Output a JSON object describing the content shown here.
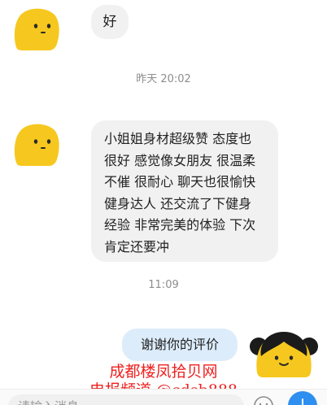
{
  "messages": {
    "first": {
      "text": "好"
    },
    "second": {
      "lines": [
        "小姐姐身材超级赞 态度也",
        "很好 感觉像女朋友 很温柔",
        "不催 很耐心 聊天也很愉快",
        "健身达人 还交流了下健身",
        "经验 非常完美的体验 下次",
        "肯定还要冲"
      ]
    },
    "reply": {
      "text": "谢谢你的评价"
    }
  },
  "timestamps": {
    "first": "昨天 20:02",
    "second": "11:09"
  },
  "watermark": {
    "line1": "成都楼凤拾贝网",
    "line2": "电报频道 @cdsb888"
  },
  "input": {
    "placeholder": "请输入消息"
  },
  "colors": {
    "avatar_yellow": "#f6c81f",
    "reply_bubble": "#dcecfb",
    "accent_blue": "#2f8ff0",
    "watermark_red": "#ee2020"
  },
  "icons": {
    "emoji": "smiley-icon",
    "plus": "plus-icon"
  }
}
